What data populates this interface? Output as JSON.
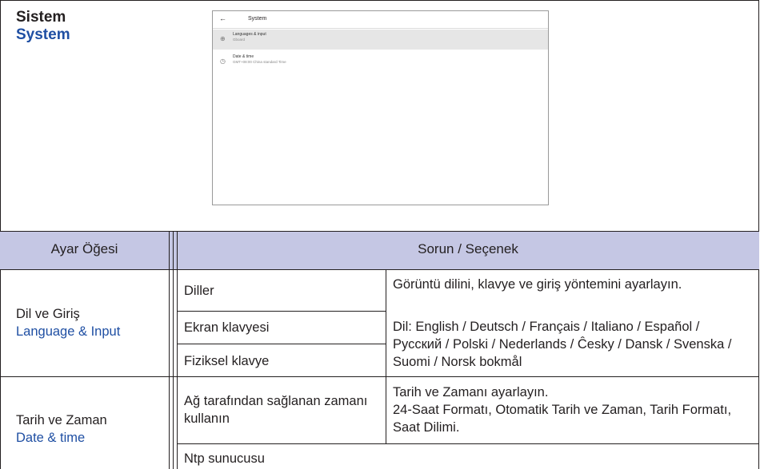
{
  "section": {
    "title_tr": "Sistem",
    "title_en": "System"
  },
  "screenshot": {
    "title": "System",
    "items": [
      {
        "label": "Languages & input",
        "sub": "Gboard",
        "icon": "globe-icon"
      },
      {
        "label": "Date & time",
        "sub": "GMT+08:00 China standard Time",
        "icon": "clock-icon"
      }
    ]
  },
  "table": {
    "header_item": "Ayar Öğesi",
    "header_option": "Sorun / Seçenek",
    "rows": {
      "language": {
        "item_tr": "Dil ve Giriş",
        "item_en": "Language & Input",
        "sub1": "Diller",
        "sub2": "Ekran klavyesi",
        "sub3": "Fiziksel klavye",
        "desc1": "Görüntü dilini, klavye ve giriş yöntemini ayarlayın.",
        "desc2": "Dil: English / Deutsch / Français / Italiano / Español / Русский / Polski / Nederlands / Ĉesky / Dansk / Svenska / Suomi / Norsk bokmål"
      },
      "datetime": {
        "item_tr": "Tarih ve Zaman",
        "item_en": "Date & time",
        "sub1": "Ağ tarafından sağlanan zamanı kullanın",
        "sub2": "Ntp sunucusu",
        "desc": "Tarih ve Zamanı ayarlayın.\n24-Saat Formatı, Otomatik Tarih ve Zaman, Tarih Formatı, Saat Dilimi."
      }
    }
  }
}
